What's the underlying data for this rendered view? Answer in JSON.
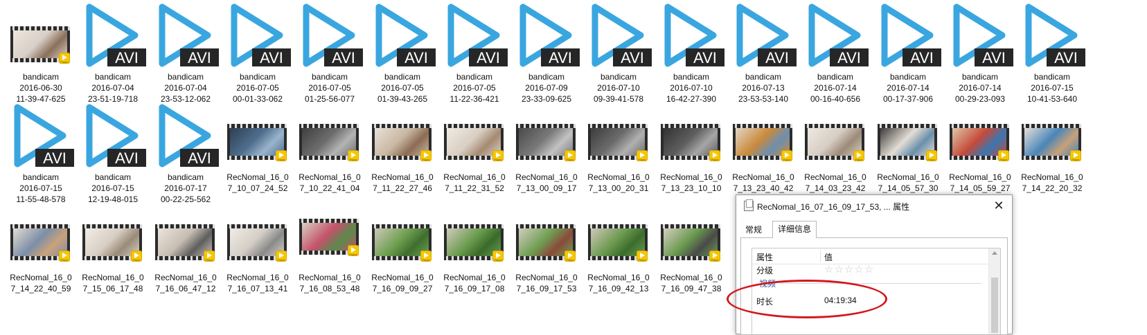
{
  "files": [
    {
      "type": "thumb",
      "line1": "bandicam",
      "line2": "2016-06-30",
      "line3": "11-39-47-625",
      "colors": [
        "#d8d0c8",
        "#8b6f5a",
        "#efe7dd"
      ]
    },
    {
      "type": "avi",
      "line1": "bandicam",
      "line2": "2016-07-04",
      "line3": "23-51-19-718"
    },
    {
      "type": "avi",
      "line1": "bandicam",
      "line2": "2016-07-04",
      "line3": "23-53-12-062"
    },
    {
      "type": "avi",
      "line1": "bandicam",
      "line2": "2016-07-05",
      "line3": "00-01-33-062"
    },
    {
      "type": "avi",
      "line1": "bandicam",
      "line2": "2016-07-05",
      "line3": "01-25-56-077"
    },
    {
      "type": "avi",
      "line1": "bandicam",
      "line2": "2016-07-05",
      "line3": "01-39-43-265"
    },
    {
      "type": "avi",
      "line1": "bandicam",
      "line2": "2016-07-05",
      "line3": "11-22-36-421"
    },
    {
      "type": "avi",
      "line1": "bandicam",
      "line2": "2016-07-09",
      "line3": "23-33-09-625"
    },
    {
      "type": "avi",
      "line1": "bandicam",
      "line2": "2016-07-10",
      "line3": "09-39-41-578"
    },
    {
      "type": "avi",
      "line1": "bandicam",
      "line2": "2016-07-10",
      "line3": "16-42-27-390"
    },
    {
      "type": "avi",
      "line1": "bandicam",
      "line2": "2016-07-13",
      "line3": "23-53-53-140"
    },
    {
      "type": "avi",
      "line1": "bandicam",
      "line2": "2016-07-14",
      "line3": "00-16-40-656"
    },
    {
      "type": "avi",
      "line1": "bandicam",
      "line2": "2016-07-14",
      "line3": "00-17-37-906"
    },
    {
      "type": "avi",
      "line1": "bandicam",
      "line2": "2016-07-14",
      "line3": "00-29-23-093"
    },
    {
      "type": "avi",
      "line1": "bandicam",
      "line2": "2016-07-15",
      "line3": "10-41-53-640"
    },
    {
      "type": "avi",
      "line1": "bandicam",
      "line2": "2016-07-15",
      "line3": "11-55-48-578"
    },
    {
      "type": "avi",
      "line1": "bandicam",
      "line2": "2016-07-15",
      "line3": "12-19-48-015"
    },
    {
      "type": "avi",
      "line1": "bandicam",
      "line2": "2016-07-17",
      "line3": "00-22-25-562"
    },
    {
      "type": "thumb",
      "line1": "RecNomal_16_0",
      "line2": "7_10_07_24_52",
      "colors": [
        "#4f6f8f",
        "#9ab4cc",
        "#2d3e52"
      ]
    },
    {
      "type": "thumb",
      "line1": "RecNomal_16_0",
      "line2": "7_10_22_41_04",
      "colors": [
        "#6e6e6e",
        "#b4b4b4",
        "#3e3e3e"
      ]
    },
    {
      "type": "thumb",
      "line1": "RecNomal_16_0",
      "line2": "7_11_22_27_46",
      "colors": [
        "#c9b7a2",
        "#8d6b54",
        "#e8e1d8"
      ]
    },
    {
      "type": "thumb",
      "line1": "RecNomal_16_0",
      "line2": "7_11_22_31_52",
      "colors": [
        "#d9cfc2",
        "#a58a72",
        "#f0ebe4"
      ]
    },
    {
      "type": "thumb",
      "line1": "RecNomal_16_0",
      "line2": "7_13_00_09_17",
      "colors": [
        "#7a7a7a",
        "#c2c2c2",
        "#4a4a4a"
      ]
    },
    {
      "type": "thumb",
      "line1": "RecNomal_16_0",
      "line2": "7_13_00_20_31",
      "colors": [
        "#6c6c6c",
        "#b0b0b0",
        "#3c3c3c"
      ]
    },
    {
      "type": "thumb",
      "line1": "RecNomal_16_0",
      "line2": "7_13_23_10_10",
      "colors": [
        "#5e5e5e",
        "#a6a6a6",
        "#323232"
      ]
    },
    {
      "type": "thumb",
      "line1": "RecNomal_16_0",
      "line2": "7_13_23_40_42",
      "colors": [
        "#c88a3c",
        "#6c8fb0",
        "#e4d6c4"
      ]
    },
    {
      "type": "thumb",
      "line1": "RecNomal_16_0",
      "line2": "7_14_03_23_42",
      "colors": [
        "#d6cec4",
        "#9c8a78",
        "#efe9e2"
      ]
    },
    {
      "type": "thumb",
      "line1": "RecNomal_16_0",
      "line2": "7_14_05_57_30",
      "colors": [
        "#e4ddd4",
        "#6a8faa",
        "#3a3a3a"
      ]
    },
    {
      "type": "thumb",
      "line1": "RecNomal_16_0",
      "line2": "7_14_05_59_27",
      "colors": [
        "#c44a3a",
        "#3a76b0",
        "#e0c8a8"
      ]
    },
    {
      "type": "thumb",
      "line1": "RecNomal_16_0",
      "line2": "7_14_22_20_32",
      "colors": [
        "#4a86b8",
        "#c9a07a",
        "#e6e0d8"
      ]
    },
    {
      "type": "thumb",
      "line1": "RecNomal_16_0",
      "line2": "7_14_22_40_59",
      "colors": [
        "#7c8ea8",
        "#c9a27a",
        "#e3dcd2"
      ]
    },
    {
      "type": "thumb",
      "line1": "RecNomal_16_0",
      "line2": "7_15_06_17_48",
      "colors": [
        "#d8cfc4",
        "#9a8a78",
        "#f1ece6"
      ]
    },
    {
      "type": "thumb",
      "line1": "RecNomal_16_0",
      "line2": "7_16_06_47_12",
      "colors": [
        "#c7bdb2",
        "#5e5e5e",
        "#ebe5de"
      ]
    },
    {
      "type": "thumb",
      "line1": "RecNomal_16_0",
      "line2": "7_16_07_13_41",
      "colors": [
        "#d4cec6",
        "#8a8a8a",
        "#f0ece6"
      ]
    },
    {
      "type": "thumb",
      "line1": "RecNomal_16_0",
      "line2": "7_16_08_53_48",
      "colors": [
        "#c4526a",
        "#5a8a4a",
        "#d9cfc2"
      ]
    },
    {
      "type": "thumb",
      "line1": "RecNomal_16_0",
      "line2": "7_16_09_09_27",
      "colors": [
        "#6fa050",
        "#3e6e2e",
        "#cfc7bc"
      ]
    },
    {
      "type": "thumb",
      "line1": "RecNomal_16_0",
      "line2": "7_16_09_17_08",
      "colors": [
        "#6a9c4e",
        "#3a6a2a",
        "#d2cabe"
      ]
    },
    {
      "type": "thumb",
      "line1": "RecNomal_16_0",
      "line2": "7_16_09_17_53",
      "colors": [
        "#6e9e52",
        "#8a4a3a",
        "#d4ccc0"
      ]
    },
    {
      "type": "thumb",
      "line1": "RecNomal_16_0",
      "line2": "7_16_09_42_13",
      "colors": [
        "#6c9a50",
        "#3c6c2c",
        "#d0c8bc"
      ]
    },
    {
      "type": "thumb",
      "line1": "RecNomal_16_0",
      "line2": "7_16_09_47_38",
      "colors": [
        "#6a9a4e",
        "#4a4a4a",
        "#d6cec2"
      ]
    }
  ],
  "icons": {
    "avi_text": "AVI",
    "avi_play_color": "#3aa6e0",
    "badge_text": "Player",
    "badge_color": "#f6c700"
  },
  "dialog": {
    "title": "RecNomal_16_07_16_09_17_53, ... 属性",
    "close_glyph": "✕",
    "tabs": [
      "常规",
      "详细信息"
    ],
    "active_tab": "详细信息",
    "header_name": "属性",
    "header_value": "值",
    "rating_label": "分级",
    "rating_stars": "☆☆☆☆☆",
    "group_label": "视频",
    "duration_label": "时长",
    "duration_value": "04:19:34"
  },
  "highlight_color": "#d4181d"
}
